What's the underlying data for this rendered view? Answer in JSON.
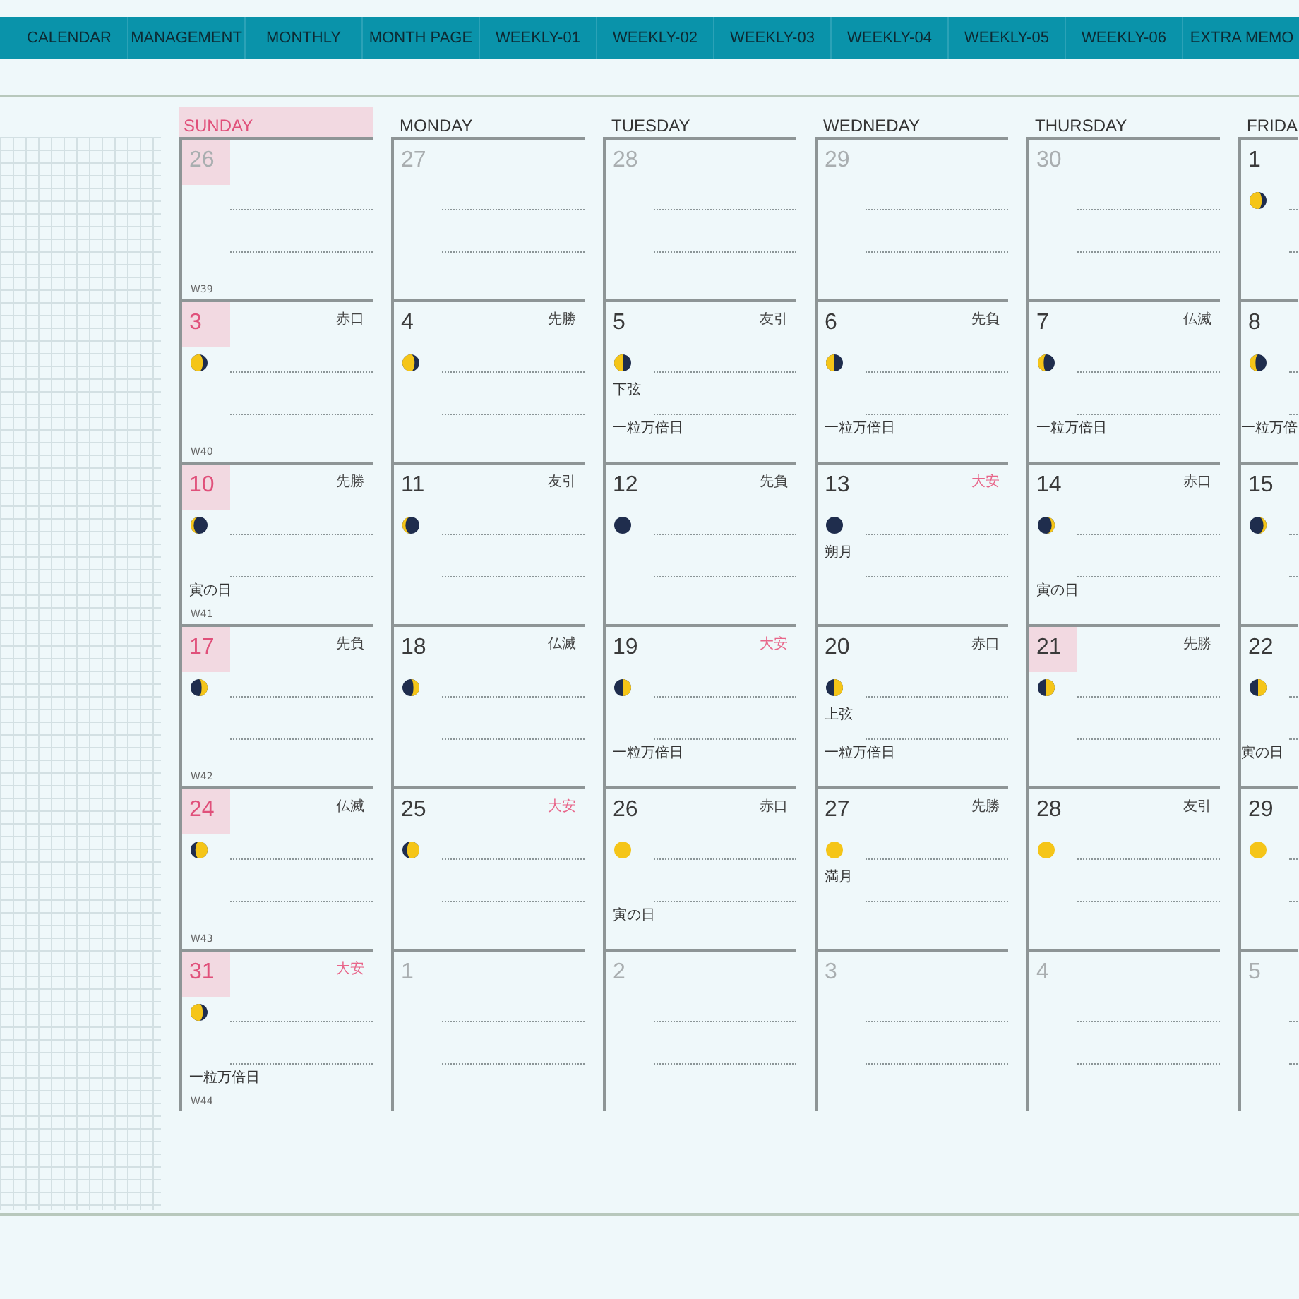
{
  "tabs": [
    {
      "label": "CALENDAR"
    },
    {
      "label": "MANAGEMENT"
    },
    {
      "label": "MONTHLY"
    },
    {
      "label": "MONTH PAGE"
    },
    {
      "label": "WEEKLY-01"
    },
    {
      "label": "WEEKLY-02"
    },
    {
      "label": "WEEKLY-03"
    },
    {
      "label": "WEEKLY-04"
    },
    {
      "label": "WEEKLY-05"
    },
    {
      "label": "WEEKLY-06"
    },
    {
      "label": "EXTRA MEMO"
    }
  ],
  "calendar": {
    "weekdays": [
      {
        "label": "SUNDAY",
        "highlighted": true
      },
      {
        "label": "MONDAY",
        "highlighted": false
      },
      {
        "label": "TUESDAY",
        "highlighted": false
      },
      {
        "label": "WEDNEDAY",
        "highlighted": false
      },
      {
        "label": "THURSDAY",
        "highlighted": false
      },
      {
        "label": "FRIDA",
        "highlighted": false
      }
    ],
    "weeks": [
      {
        "week_label": "W39",
        "days": [
          {
            "day": "26",
            "muted": true,
            "highlighted": true
          },
          {
            "day": "27",
            "muted": true,
            "highlighted": false
          },
          {
            "day": "28",
            "muted": true,
            "highlighted": false
          },
          {
            "day": "29",
            "muted": true,
            "highlighted": false
          },
          {
            "day": "30",
            "muted": true,
            "highlighted": false
          },
          {
            "day": "1",
            "muted": false,
            "highlighted": false,
            "moon": {
              "kind": "waning_gibbous"
            }
          }
        ]
      },
      {
        "week_label": "W40",
        "days": [
          {
            "day": "3",
            "muted": false,
            "highlighted": true,
            "rokuyo": {
              "text": "赤口",
              "color": "#444444"
            },
            "moon": {
              "kind": "waning_gibbous"
            }
          },
          {
            "day": "4",
            "muted": false,
            "highlighted": false,
            "rokuyo": {
              "text": "先勝",
              "color": "#444444"
            },
            "moon": {
              "kind": "waning_gibbous"
            }
          },
          {
            "day": "5",
            "muted": false,
            "highlighted": false,
            "rokuyo": {
              "text": "友引",
              "color": "#444444"
            },
            "moon": {
              "kind": "last_quarter"
            },
            "phase_note": "下弦",
            "note": "一粒万倍日"
          },
          {
            "day": "6",
            "muted": false,
            "highlighted": false,
            "rokuyo": {
              "text": "先負",
              "color": "#444444"
            },
            "moon": {
              "kind": "last_quarter"
            },
            "note": "一粒万倍日"
          },
          {
            "day": "7",
            "muted": false,
            "highlighted": false,
            "rokuyo": {
              "text": "仏滅",
              "color": "#444444"
            },
            "moon": {
              "kind": "waning_crescent"
            },
            "note": "一粒万倍日"
          },
          {
            "day": "8",
            "muted": false,
            "highlighted": false,
            "moon": {
              "kind": "waning_crescent"
            },
            "note": "一粒万倍"
          }
        ]
      },
      {
        "week_label": "W41",
        "days": [
          {
            "day": "10",
            "muted": false,
            "highlighted": true,
            "rokuyo": {
              "text": "先勝",
              "color": "#444444"
            },
            "moon": {
              "kind": "thin_waning"
            },
            "note": "寅の日"
          },
          {
            "day": "11",
            "muted": false,
            "highlighted": false,
            "rokuyo": {
              "text": "友引",
              "color": "#444444"
            },
            "moon": {
              "kind": "thin_waning"
            }
          },
          {
            "day": "12",
            "muted": false,
            "highlighted": false,
            "rokuyo": {
              "text": "先負",
              "color": "#444444"
            },
            "moon": {
              "kind": "new"
            }
          },
          {
            "day": "13",
            "muted": false,
            "highlighted": false,
            "rokuyo": {
              "text": "大安",
              "color": "#e8668a"
            },
            "moon": {
              "kind": "new"
            },
            "phase_note": "朔月"
          },
          {
            "day": "14",
            "muted": false,
            "highlighted": false,
            "rokuyo": {
              "text": "赤口",
              "color": "#444444"
            },
            "moon": {
              "kind": "thin_waxing"
            },
            "note": "寅の日"
          },
          {
            "day": "15",
            "muted": false,
            "highlighted": false,
            "moon": {
              "kind": "thin_waxing"
            }
          }
        ]
      },
      {
        "week_label": "W42",
        "days": [
          {
            "day": "17",
            "muted": false,
            "highlighted": true,
            "rokuyo": {
              "text": "先負",
              "color": "#444444"
            },
            "moon": {
              "kind": "waxing_crescent"
            }
          },
          {
            "day": "18",
            "muted": false,
            "highlighted": false,
            "rokuyo": {
              "text": "仏滅",
              "color": "#444444"
            },
            "moon": {
              "kind": "waxing_crescent"
            }
          },
          {
            "day": "19",
            "muted": false,
            "highlighted": false,
            "rokuyo": {
              "text": "大安",
              "color": "#e8668a"
            },
            "moon": {
              "kind": "first_quarter"
            },
            "note": "一粒万倍日"
          },
          {
            "day": "20",
            "muted": false,
            "highlighted": false,
            "rokuyo": {
              "text": "赤口",
              "color": "#444444"
            },
            "moon": {
              "kind": "first_quarter"
            },
            "phase_note": "上弦",
            "note": "一粒万倍日"
          },
          {
            "day": "21",
            "muted": false,
            "highlighted": true,
            "rokuyo": {
              "text": "先勝",
              "color": "#444444"
            },
            "moon": {
              "kind": "first_quarter"
            }
          },
          {
            "day": "22",
            "muted": false,
            "highlighted": false,
            "moon": {
              "kind": "first_quarter"
            },
            "note": "寅の日"
          }
        ]
      },
      {
        "week_label": "W43",
        "days": [
          {
            "day": "24",
            "muted": false,
            "highlighted": true,
            "rokuyo": {
              "text": "仏滅",
              "color": "#444444"
            },
            "moon": {
              "kind": "waxing_gibbous"
            }
          },
          {
            "day": "25",
            "muted": false,
            "highlighted": false,
            "rokuyo": {
              "text": "大安",
              "color": "#e8668a"
            },
            "moon": {
              "kind": "waxing_gibbous"
            }
          },
          {
            "day": "26",
            "muted": false,
            "highlighted": false,
            "rokuyo": {
              "text": "赤口",
              "color": "#444444"
            },
            "moon": {
              "kind": "full"
            },
            "note": "寅の日"
          },
          {
            "day": "27",
            "muted": false,
            "highlighted": false,
            "rokuyo": {
              "text": "先勝",
              "color": "#444444"
            },
            "moon": {
              "kind": "full"
            },
            "phase_note": "満月"
          },
          {
            "day": "28",
            "muted": false,
            "highlighted": false,
            "rokuyo": {
              "text": "友引",
              "color": "#444444"
            },
            "moon": {
              "kind": "full"
            }
          },
          {
            "day": "29",
            "muted": false,
            "highlighted": false,
            "moon": {
              "kind": "full"
            }
          }
        ]
      },
      {
        "week_label": "W44",
        "days": [
          {
            "day": "31",
            "muted": false,
            "highlighted": true,
            "rokuyo": {
              "text": "大安",
              "color": "#e8668a"
            },
            "moon": {
              "kind": "waning_gibbous"
            },
            "note": "一粒万倍日"
          },
          {
            "day": "1",
            "muted": true,
            "highlighted": false
          },
          {
            "day": "2",
            "muted": true,
            "highlighted": false
          },
          {
            "day": "3",
            "muted": true,
            "highlighted": false
          },
          {
            "day": "4",
            "muted": true,
            "highlighted": false
          },
          {
            "day": "5",
            "muted": true,
            "highlighted": false
          }
        ]
      }
    ]
  }
}
